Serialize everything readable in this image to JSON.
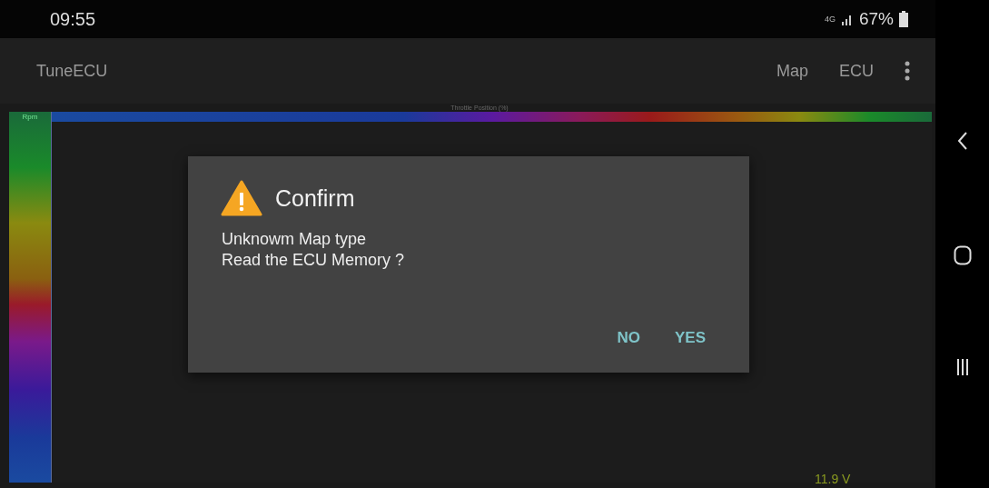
{
  "status_bar": {
    "time": "09:55",
    "network": "4G",
    "battery": "67%"
  },
  "app_bar": {
    "title": "TuneECU",
    "actions": [
      "Map",
      "ECU"
    ]
  },
  "map": {
    "x_axis_title": "Throttle Position (%)",
    "y_axis_title": "Rpm",
    "voltage": "11.9 V"
  },
  "dialog": {
    "title": "Confirm",
    "lines": [
      "Unknowm Map type",
      "Read the ECU Memory ?"
    ],
    "buttons": [
      "NO",
      "YES"
    ]
  }
}
